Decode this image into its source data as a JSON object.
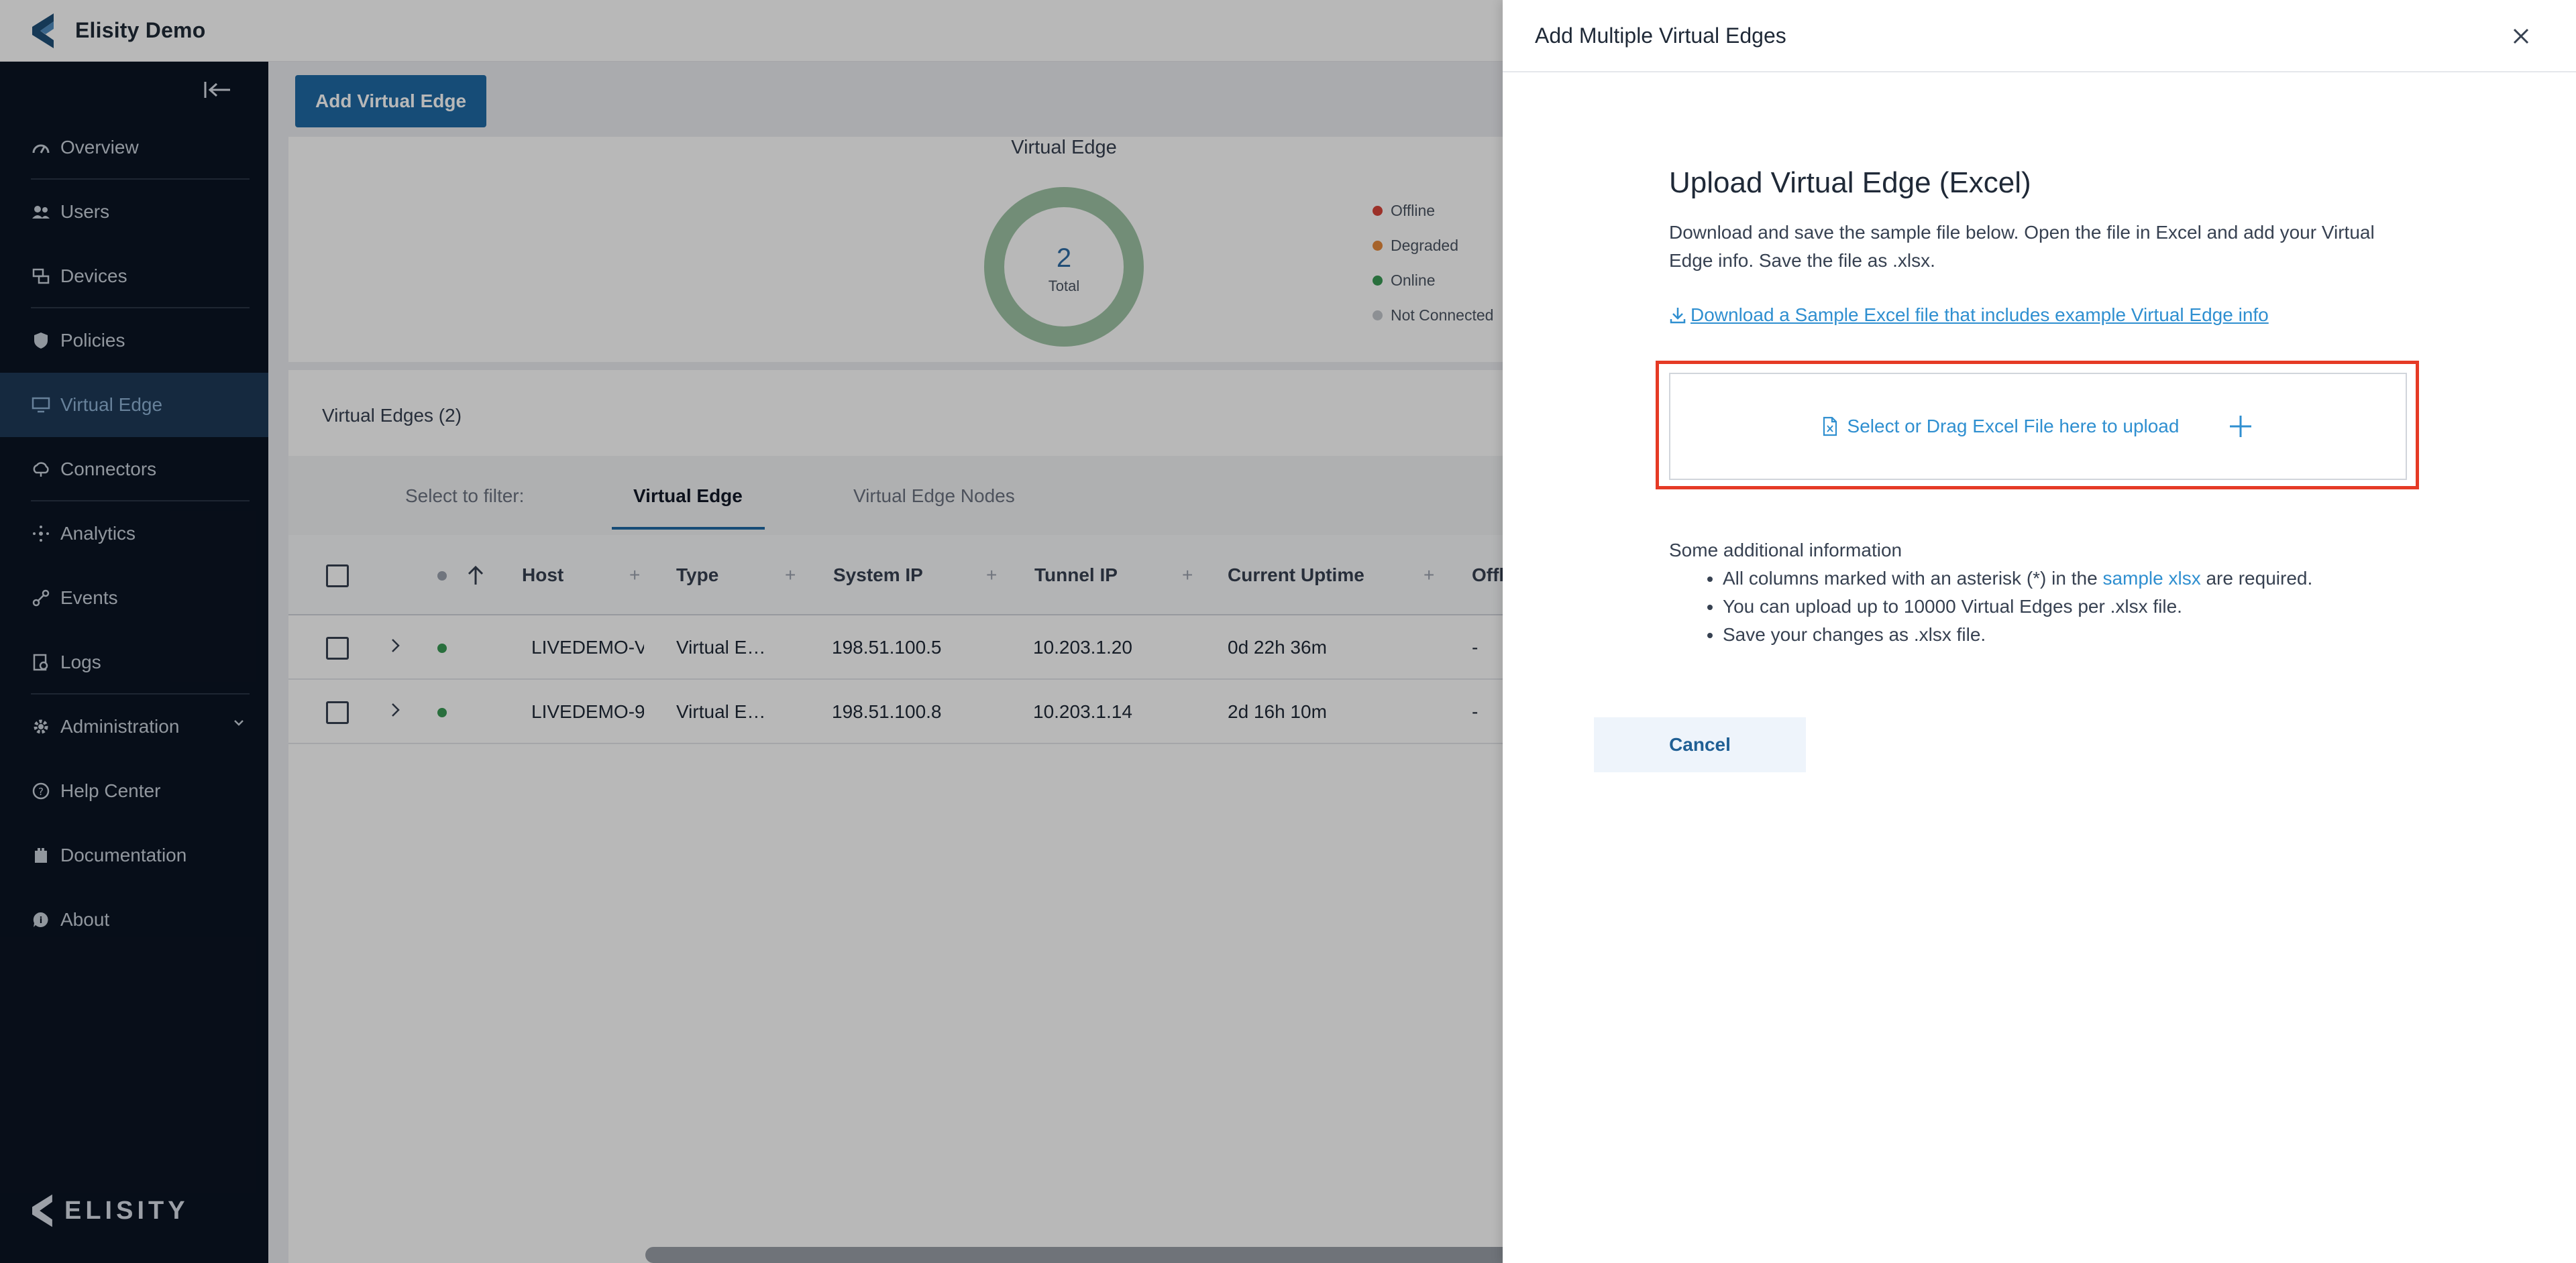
{
  "app": {
    "name": "Elisity Demo",
    "footer_logo_text": "ELISITY"
  },
  "sidebar": {
    "items": [
      {
        "label": "Overview",
        "icon": "dashboard-gauge-icon"
      },
      {
        "label": "Users",
        "icon": "users-icon"
      },
      {
        "label": "Devices",
        "icon": "devices-icon"
      },
      {
        "label": "Policies",
        "icon": "shield-icon"
      },
      {
        "label": "Virtual Edge",
        "icon": "monitor-icon",
        "active": true
      },
      {
        "label": "Connectors",
        "icon": "cloud-connector-icon"
      },
      {
        "label": "Analytics",
        "icon": "analytics-icon"
      },
      {
        "label": "Events",
        "icon": "events-icon"
      },
      {
        "label": "Logs",
        "icon": "logs-icon"
      },
      {
        "label": "Administration",
        "icon": "gear-icon"
      },
      {
        "label": "Help Center",
        "icon": "help-icon"
      },
      {
        "label": "Documentation",
        "icon": "book-icon"
      },
      {
        "label": "About",
        "icon": "chat-info-icon"
      }
    ]
  },
  "toolbar": {
    "add_label": "Add Virtual Edge"
  },
  "summary": {
    "title": "Virtual Edge",
    "total_value": "2",
    "total_label": "Total",
    "legend": [
      {
        "label": "Offline",
        "color": "#d9443a"
      },
      {
        "label": "Degraded",
        "color": "#e68a3c"
      },
      {
        "label": "Online",
        "color": "#3a9a55"
      },
      {
        "label": "Not Connected",
        "color": "#c4c8ce"
      }
    ],
    "donut_color": "#9fc4a6"
  },
  "list": {
    "title": "Virtual Edges (2)",
    "filter_label": "Select to filter:",
    "tabs": [
      "Virtual Edge",
      "Virtual Edge Nodes"
    ],
    "columns": [
      "Host",
      "Type",
      "System IP",
      "Tunnel IP",
      "Current Uptime",
      "Offl"
    ],
    "rows": [
      {
        "host": "LIVEDEMO-V",
        "type": "Virtual E…",
        "system_ip": "198.51.100.5",
        "tunnel_ip": "10.203.1.20",
        "uptime": "0d 22h 36m",
        "offline": "-"
      },
      {
        "host": "LIVEDEMO-9",
        "type": "Virtual E…",
        "system_ip": "198.51.100.8",
        "tunnel_ip": "10.203.1.14",
        "uptime": "2d 16h 10m",
        "offline": "-"
      }
    ]
  },
  "drawer": {
    "title": "Add Multiple Virtual Edges",
    "upload_title": "Upload Virtual Edge (Excel)",
    "description": "Download and save the sample file below. Open the file in Excel and add your Virtual Edge info. Save the file as .xlsx.",
    "download_link": "Download a Sample Excel file that includes example Virtual Edge info",
    "dropzone_text": "Select or Drag Excel File here to upload",
    "info_heading": "Some additional information",
    "info_items": {
      "first_prefix": "All columns marked with an asterisk (*) in the",
      "first_link": "sample xlsx",
      "first_suffix": "are required.",
      "second": "You can upload up to 10000 Virtual Edges per .xlsx file.",
      "third": "Save your changes as .xlsx file."
    },
    "cancel_label": "Cancel",
    "accent_color": "#2f8fd0",
    "highlight_color": "#e53a25"
  }
}
